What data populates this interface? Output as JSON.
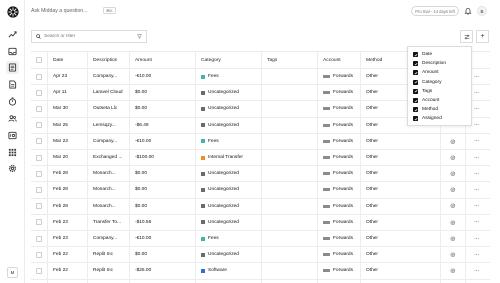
{
  "header": {
    "ask_placeholder": "Ask Midday a question...",
    "shortcut": "⌘K",
    "trial_text": "Pro trial - 14 days left",
    "avatar_initial": "B"
  },
  "sidebar": {
    "user_initials": "M",
    "items": [
      {
        "icon": "chart-icon"
      },
      {
        "icon": "inbox-icon"
      },
      {
        "icon": "transactions-icon"
      },
      {
        "icon": "invoices-icon"
      },
      {
        "icon": "tracker-icon"
      },
      {
        "icon": "customers-icon"
      },
      {
        "icon": "vault-icon"
      },
      {
        "icon": "apps-icon"
      },
      {
        "icon": "settings-icon"
      }
    ]
  },
  "toolbar": {
    "search_placeholder": "Search or filter",
    "add_label": "+"
  },
  "table": {
    "headers": {
      "date": "Date",
      "description": "Description",
      "amount": "Amount",
      "category": "Category",
      "tags": "Tags",
      "account": "Account",
      "method": "Method"
    },
    "rows": [
      {
        "date": "Apr 23",
        "description": "Company...",
        "amount": "-€10.00",
        "category": "Fees",
        "cat_color": "#3fb6a8",
        "account": "Forwards",
        "method": "Other",
        "assigned": false
      },
      {
        "date": "Apr 11",
        "description": "Laravel Cloud",
        "amount": "$0.00",
        "category": "Uncategorized",
        "cat_color": "#6b6b6b",
        "account": "Forwards",
        "method": "Other",
        "assigned": false
      },
      {
        "date": "Mar 30",
        "description": "Outseta Llc",
        "amount": "$0.00",
        "category": "Uncategorized",
        "cat_color": "#6b6b6b",
        "account": "Forwards",
        "method": "Other",
        "assigned": false
      },
      {
        "date": "Mar 25",
        "description": "Lemsqzy...",
        "amount": "-$6.49",
        "category": "Uncategorized",
        "cat_color": "#6b6b6b",
        "account": "Forwards",
        "method": "Other",
        "assigned": false
      },
      {
        "date": "Mar 23",
        "description": "Company...",
        "amount": "-€10.00",
        "category": "Fees",
        "cat_color": "#3fb6a8",
        "account": "Forwards",
        "method": "Other",
        "assigned": true
      },
      {
        "date": "Mar 20",
        "description": "Exchanged ...",
        "amount": "-$100.00",
        "category": "Internal Transfer",
        "cat_color": "#f28c28",
        "account": "Forwards",
        "method": "Other",
        "assigned": true
      },
      {
        "date": "Feb 28",
        "description": "Monarch...",
        "amount": "$0.00",
        "category": "Uncategorized",
        "cat_color": "#6b6b6b",
        "account": "Forwards",
        "method": "Other",
        "assigned": true
      },
      {
        "date": "Feb 28",
        "description": "Monarch...",
        "amount": "$0.00",
        "category": "Uncategorized",
        "cat_color": "#6b6b6b",
        "account": "Forwards",
        "method": "Other",
        "assigned": true
      },
      {
        "date": "Feb 28",
        "description": "Monarch...",
        "amount": "$0.00",
        "category": "Uncategorized",
        "cat_color": "#6b6b6b",
        "account": "Forwards",
        "method": "Other",
        "assigned": true
      },
      {
        "date": "Feb 23",
        "description": "Transfer To...",
        "amount": "-$10.56",
        "category": "Uncategorized",
        "cat_color": "#6b6b6b",
        "account": "Forwards",
        "method": "Other",
        "assigned": true
      },
      {
        "date": "Feb 23",
        "description": "Company...",
        "amount": "-€10.00",
        "category": "Fees",
        "cat_color": "#3fb6a8",
        "account": "Forwards",
        "method": "Other",
        "assigned": true
      },
      {
        "date": "Feb 22",
        "description": "Replit Inc",
        "amount": "$0.00",
        "category": "Uncategorized",
        "cat_color": "#6b6b6b",
        "account": "Forwards",
        "method": "Other",
        "assigned": true
      },
      {
        "date": "Feb 22",
        "description": "Replit Inc",
        "amount": "-$25.00",
        "category": "Software",
        "cat_color": "#2f6fdd",
        "account": "Forwards",
        "method": "Other",
        "assigned": true
      }
    ]
  },
  "columns_menu": {
    "items": [
      "Date",
      "Description",
      "Amount",
      "Category",
      "Tags",
      "Account",
      "Method",
      "Assigned"
    ]
  }
}
